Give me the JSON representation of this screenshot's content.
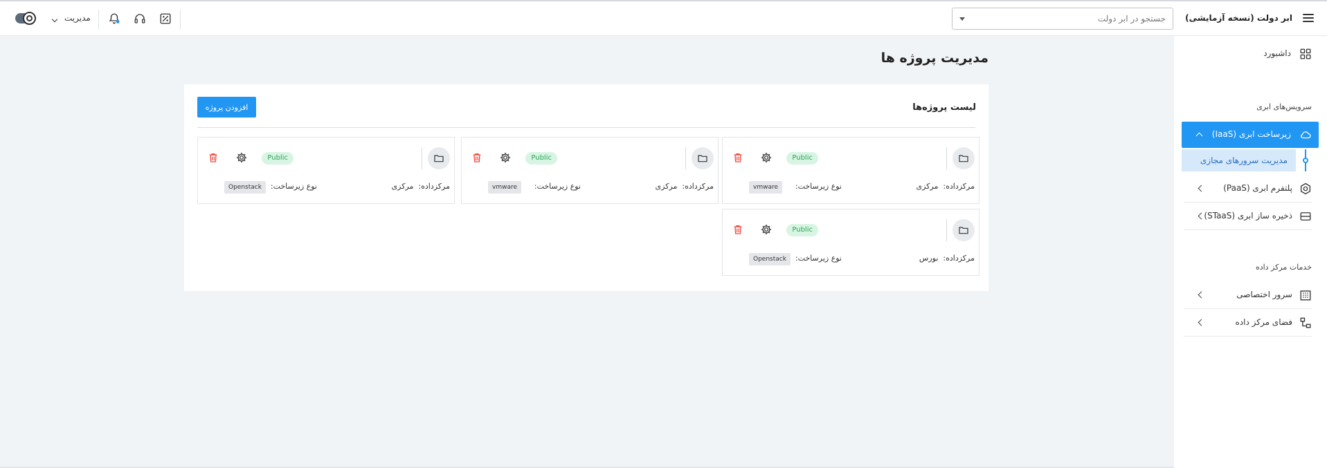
{
  "app": {
    "title": "ابر دولت (نسخه آزمایشی)"
  },
  "header": {
    "search_placeholder": "جستجو در ابر دولت",
    "role_label": "مدیریت",
    "icons": [
      "toggle-theme-icon",
      "chevron-down-icon",
      "bell-icon",
      "headset-icon",
      "percent-icon"
    ]
  },
  "sidebar": {
    "dashboard": "داشبورد",
    "section_cloud": "سرویس‌های ابری",
    "iaas": "زیرساخت ابری (IaaS)",
    "iaas_sub": "مدیریت سرورهای مجازی",
    "paas": "پلتفرم ابری (PaaS)",
    "staas": "ذخیره ساز ابری (STaaS)",
    "section_dc": "خدمات مرکز داده",
    "dedicated": "سرور اختصاصی",
    "dc_space": "فضای مرکز داده"
  },
  "main": {
    "page_title": "مدیریت پروژه ها",
    "list_title": "لیست پروژه‌ها",
    "add_button": "افزودن پروژه",
    "dc_prefix": "مرکزداده:",
    "infra_prefix": "نوع زیرساخت:",
    "projects": [
      {
        "badge": "Public",
        "datacenter": "مرکزی",
        "infra": "vmware"
      },
      {
        "badge": "Public",
        "datacenter": "مرکزی",
        "infra": "vmware"
      },
      {
        "badge": "Public",
        "datacenter": "مرکزی",
        "infra": "Openstack"
      },
      {
        "badge": "Public",
        "datacenter": "بورس",
        "infra": "Openstack"
      }
    ]
  },
  "colors": {
    "accent": "#2196f3",
    "badge_bg": "#d7f5e2",
    "badge_text": "#2fa35a",
    "delete": "#f44336"
  }
}
